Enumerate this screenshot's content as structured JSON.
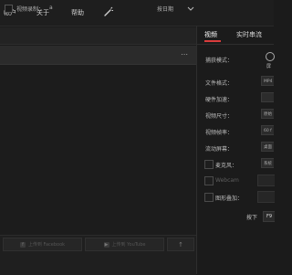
{
  "menubar": {
    "items": [
      "帐户",
      "关于",
      "帮助"
    ]
  },
  "toolbar": {
    "save_label": "视频录制：",
    "save_value": "a",
    "sort_label": "按日期"
  },
  "panel": {
    "tabs": [
      "视频",
      "实时串流"
    ],
    "capture_mode_label": "捕获模式：",
    "capture_mode_value": "屏",
    "rows": [
      {
        "label": "文件格式：",
        "value": "MP4"
      },
      {
        "label": "硬件加速：",
        "value": ""
      },
      {
        "label": "视频尺寸：",
        "value": "原始"
      },
      {
        "label": "视频帧率：",
        "value": "60 f"
      },
      {
        "label": "流动屏幕：",
        "value": "桌面"
      }
    ],
    "checks": [
      {
        "label": "麦克风：",
        "value": "系统",
        "dim": false
      },
      {
        "label": "Webcam",
        "value": "",
        "dim": true
      },
      {
        "label": "图形叠加：",
        "value": "",
        "dim": false
      }
    ],
    "record_label": "按下",
    "record_key": "F9"
  },
  "bottom": {
    "facebook": "上传到 Facebook",
    "youtube": "上传到 YouTube",
    "arrow": "↑"
  },
  "colors": {
    "accent": "#d93c3c"
  }
}
